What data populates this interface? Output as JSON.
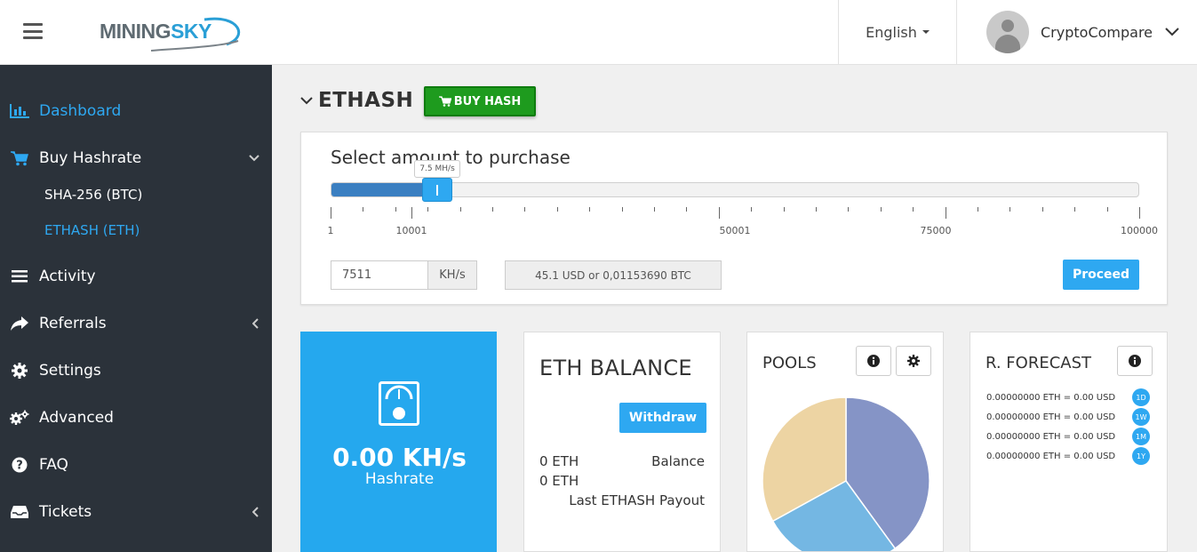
{
  "header": {
    "logo": {
      "part1": "MINING",
      "part2": "SKY"
    },
    "language": "English",
    "user_name": "CryptoCompare"
  },
  "sidebar": {
    "items": [
      {
        "label": "Dashboard"
      },
      {
        "label": "Buy Hashrate"
      },
      {
        "label": "Activity"
      },
      {
        "label": "Referrals"
      },
      {
        "label": "Settings"
      },
      {
        "label": "Advanced"
      },
      {
        "label": "FAQ"
      },
      {
        "label": "Tickets"
      }
    ],
    "sub_items": [
      {
        "label": "SHA-256 (BTC)"
      },
      {
        "label": "ETHASH (ETH)"
      }
    ]
  },
  "section": {
    "title": "ETHASH",
    "buy_button": "BUY HASH"
  },
  "purchase": {
    "title": "Select amount to purchase",
    "slider": {
      "min": 1,
      "max": 100000,
      "value": 7511,
      "tooltip": "7.5 MH/s",
      "tick_labels": [
        "1",
        "10001",
        "50001",
        "75000",
        "100000"
      ]
    },
    "amount_value": "7511",
    "amount_unit": "KH/s",
    "price_text": "45.1 USD or 0,01153690 BTC",
    "proceed_label": "Proceed"
  },
  "hashrate": {
    "value": "0.00 KH/s",
    "label": "Hashrate"
  },
  "balance": {
    "title": "ETH BALANCE",
    "withdraw_label": "Withdraw",
    "row1_value": "0 ETH",
    "row1_label": "Balance",
    "row2_value": "0 ETH",
    "row2_label": "Last ETHASH Payout"
  },
  "pools": {
    "title": "POOLS",
    "slices": [
      {
        "fraction": 0.4,
        "color": "#8594c6"
      },
      {
        "fraction": 0.27,
        "color": "#74b7e3"
      },
      {
        "fraction": 0.33,
        "color": "#edd4a3"
      }
    ]
  },
  "forecast": {
    "title": "R. FORECAST",
    "rows": [
      {
        "text": "0.00000000 ETH = 0.00 USD",
        "badge": "1D"
      },
      {
        "text": "0.00000000 ETH = 0.00 USD",
        "badge": "1W"
      },
      {
        "text": "0.00000000 ETH = 0.00 USD",
        "badge": "1M"
      },
      {
        "text": "0.00000000 ETH = 0.00 USD",
        "badge": "1Y"
      }
    ]
  },
  "colors": {
    "accent": "#2ea8f1",
    "sidebar_bg": "#2b323a",
    "buy_green": "#1e9b1e",
    "slider_fill": "#3b7fc1"
  }
}
